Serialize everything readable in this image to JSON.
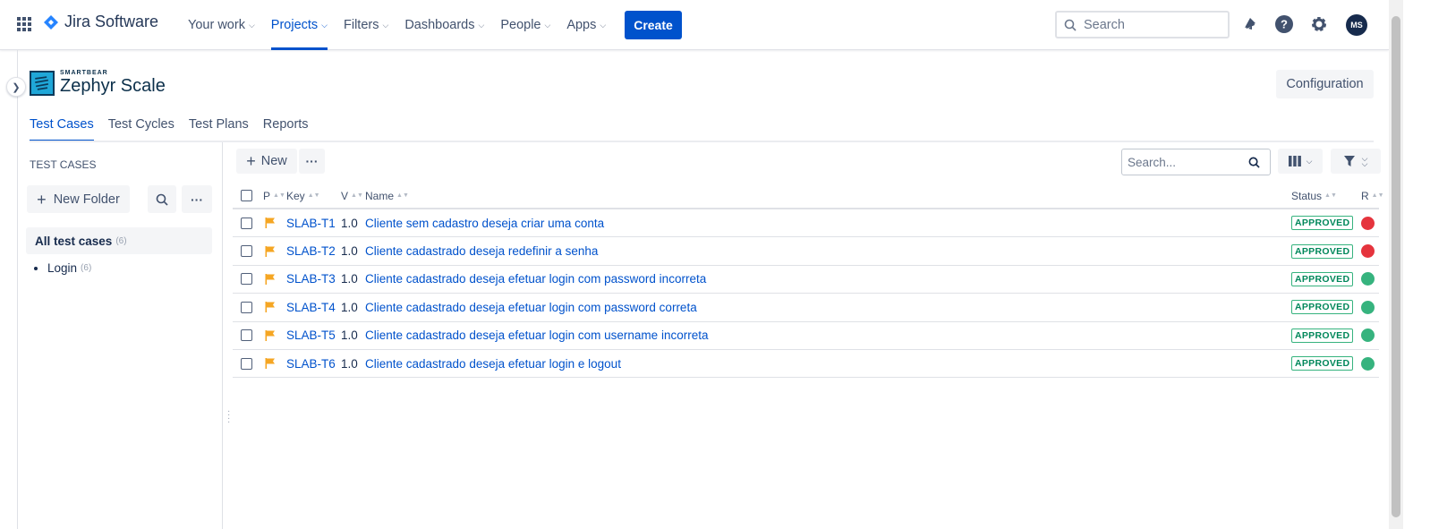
{
  "topbar": {
    "app_name": "Jira Software",
    "nav": [
      {
        "label": "Your work",
        "active": false
      },
      {
        "label": "Projects",
        "active": true
      },
      {
        "label": "Filters",
        "active": false
      },
      {
        "label": "Dashboards",
        "active": false
      },
      {
        "label": "People",
        "active": false
      },
      {
        "label": "Apps",
        "active": false
      }
    ],
    "create_label": "Create",
    "search_placeholder": "Search",
    "avatar_initials": "MS",
    "icons": [
      "app-switcher-icon",
      "jira-logo-icon",
      "notification-bell-icon",
      "help-icon",
      "settings-gear-icon"
    ]
  },
  "zephyr": {
    "brand": "SMARTBEAR",
    "product": "Zephyr Scale",
    "config_label": "Configuration",
    "tabs": [
      {
        "label": "Test Cases",
        "active": true
      },
      {
        "label": "Test Cycles",
        "active": false
      },
      {
        "label": "Test Plans",
        "active": false
      },
      {
        "label": "Reports",
        "active": false
      }
    ]
  },
  "left_panel": {
    "title": "TEST CASES",
    "new_folder_label": "New Folder",
    "all_label": "All test cases",
    "all_count": "(6)",
    "folders": [
      {
        "label": "Login",
        "count": "(6)"
      }
    ]
  },
  "main": {
    "new_label": "New",
    "search_placeholder": "Search...",
    "columns": {
      "priority": "P",
      "key": "Key",
      "version": "V",
      "name": "Name",
      "status": "Status",
      "result": "R"
    },
    "rows": [
      {
        "key": "SLAB-T1",
        "version": "1.0",
        "name": "Cliente sem cadastro deseja criar uma conta",
        "status": "APPROVED",
        "result_color": "#e5343d"
      },
      {
        "key": "SLAB-T2",
        "version": "1.0",
        "name": "Cliente cadastrado deseja redefinir a senha",
        "status": "APPROVED",
        "result_color": "#e5343d"
      },
      {
        "key": "SLAB-T3",
        "version": "1.0",
        "name": "Cliente cadastrado deseja efetuar login com password incorreta",
        "status": "APPROVED",
        "result_color": "#36b37e"
      },
      {
        "key": "SLAB-T4",
        "version": "1.0",
        "name": "Cliente cadastrado deseja efetuar login com password correta",
        "status": "APPROVED",
        "result_color": "#36b37e"
      },
      {
        "key": "SLAB-T5",
        "version": "1.0",
        "name": "Cliente cadastrado deseja efetuar login com username incorreta",
        "status": "APPROVED",
        "result_color": "#36b37e"
      },
      {
        "key": "SLAB-T6",
        "version": "1.0",
        "name": "Cliente cadastrado deseja efetuar login e logout",
        "status": "APPROVED",
        "result_color": "#36b37e"
      }
    ]
  },
  "colors": {
    "brand_blue": "#0052cc",
    "priority_flag": "#f5a623",
    "approved_green": "#36b37e"
  }
}
